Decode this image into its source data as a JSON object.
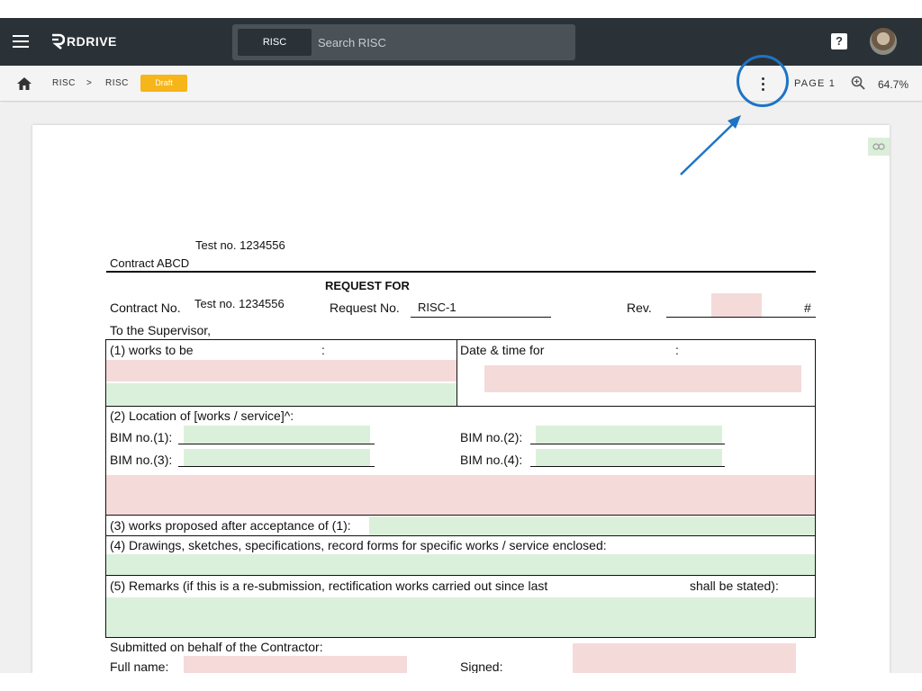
{
  "app": {
    "logo_text": "RDRIVE",
    "search_scope": "RISC",
    "search_placeholder": "Search RISC"
  },
  "toolbar": {
    "breadcrumb": [
      "RISC",
      "RISC"
    ],
    "separator": ">",
    "status_badge": "Draft",
    "page_label": "PAGE 1",
    "zoom": "64.7%"
  },
  "icons": [
    "menu-icon",
    "help-icon",
    "avatar",
    "home-icon",
    "more-vert-icon",
    "zoom-icon",
    "link-icon"
  ],
  "colors": {
    "header": "#2b3237",
    "badge": "#f6b518",
    "annotation": "#1e74c4",
    "field_red": "#f5dada",
    "field_green": "#dbf0da"
  },
  "document": {
    "test_no_top": "Test no. 1234556",
    "contract_name": "Contract ABCD",
    "heading": "REQUEST FOR",
    "contract_no_label": "Contract No.",
    "contract_no_value": "Test no. 1234556",
    "request_no_label": "Request No.",
    "request_no_value": "RISC-1",
    "rev_label": "Rev.",
    "hash": "#",
    "to_supervisor": "To the Supervisor,",
    "item1_label": "(1) works to be",
    "item1_colon": ":",
    "datetime_label": "Date & time for",
    "datetime_colon": ":",
    "item2_label": "(2) Location of [works / service]^:",
    "bim1": "BIM no.(1):",
    "bim2": "BIM no.(2):",
    "bim3": "BIM no.(3):",
    "bim4": "BIM no.(4):",
    "item3_label": "(3) works proposed after acceptance of (1):",
    "item4_label": "(4) Drawings, sketches, specifications, record forms for specific works / service enclosed:",
    "item5_label": "(5) Remarks (if this is a re-submission, rectification works carried out since last",
    "item5_suffix": "shall be stated):",
    "submitted_label": "Submitted on behalf of the Contractor:",
    "fullname_label": "Full name:",
    "signed_label": "Signed:"
  }
}
